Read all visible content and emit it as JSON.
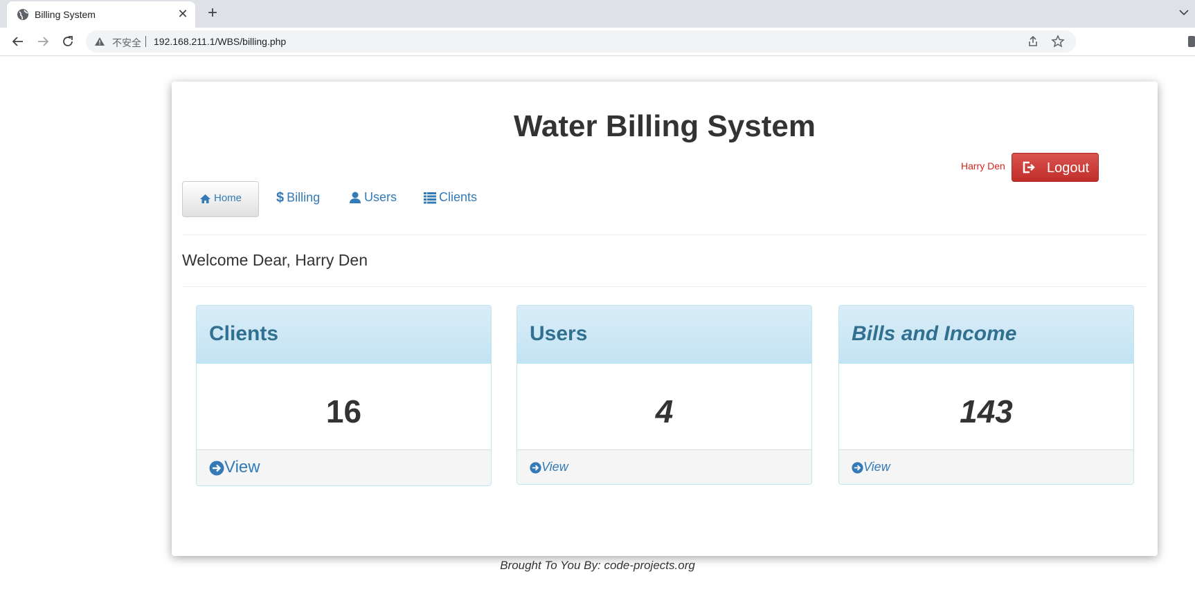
{
  "browser": {
    "tab_title": "Billing System",
    "security_label": "不安全",
    "url": "192.168.211.1/WBS/billing.php"
  },
  "header": {
    "title": "Water Billing System",
    "user_name": "Harry Den",
    "logout_label": "Logout"
  },
  "nav": {
    "items": [
      {
        "label": "Home",
        "icon": "home-icon",
        "active": true
      },
      {
        "label": "Billing",
        "icon": "dollar-icon"
      },
      {
        "label": "Users",
        "icon": "user-icon"
      },
      {
        "label": "Clients",
        "icon": "list-icon"
      }
    ]
  },
  "welcome": "Welcome Dear, Harry Den",
  "panels": [
    {
      "title": "Clients",
      "value": "16",
      "link": "View"
    },
    {
      "title": "Users",
      "value": "4",
      "link": "View"
    },
    {
      "title": "Bills and Income",
      "value": "143",
      "link": "View"
    }
  ],
  "footer": {
    "credit": "Brought To You By: code-projects.org"
  },
  "colors": {
    "link": "#337ab7",
    "danger": "#d9534f",
    "panel_heading": "#d9edf7",
    "panel_title": "#31708f"
  }
}
